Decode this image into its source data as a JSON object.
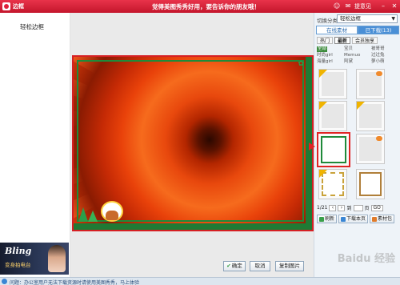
{
  "window": {
    "title": "边框",
    "slogan": "觉得美图秀秀好用，要告诉你的朋友哦！",
    "feedback": "提意见"
  },
  "left": {
    "current_name": "轻松边框",
    "ad": {
      "title": "Bling",
      "subtitle": "变身拍电台"
    }
  },
  "right": {
    "category_label": "切换分类",
    "category_value": "轻松边框",
    "mode_tabs": [
      "在线素材",
      "已下载(13)"
    ],
    "sub_tabs": [
      "热门",
      "最新",
      "会员独享"
    ],
    "tags": [
      "全部",
      "宝贝",
      "被哥哥",
      "时尚girl",
      "Memuo",
      "过过兔",
      "海量girl",
      "阿黛",
      "萝小萌"
    ],
    "pager": {
      "current": "1/21",
      "to_label": "到",
      "page_label": "页",
      "go": "GO"
    },
    "actions": [
      "刷新",
      "下载本页",
      "素材包"
    ]
  },
  "bottom": {
    "confirm": "确定",
    "cancel": "取消",
    "reset": "复制图片"
  },
  "status": {
    "text": "问题：办公室用户无法下载资源时请使用美图秀秀，马上体验"
  },
  "watermark": "Baidu 经验",
  "colors": {
    "title_bar": "#d41f35",
    "accent_blue": "#4a8fd6",
    "frame_green": "#1f8a3a",
    "selection_red": "#e02424"
  }
}
